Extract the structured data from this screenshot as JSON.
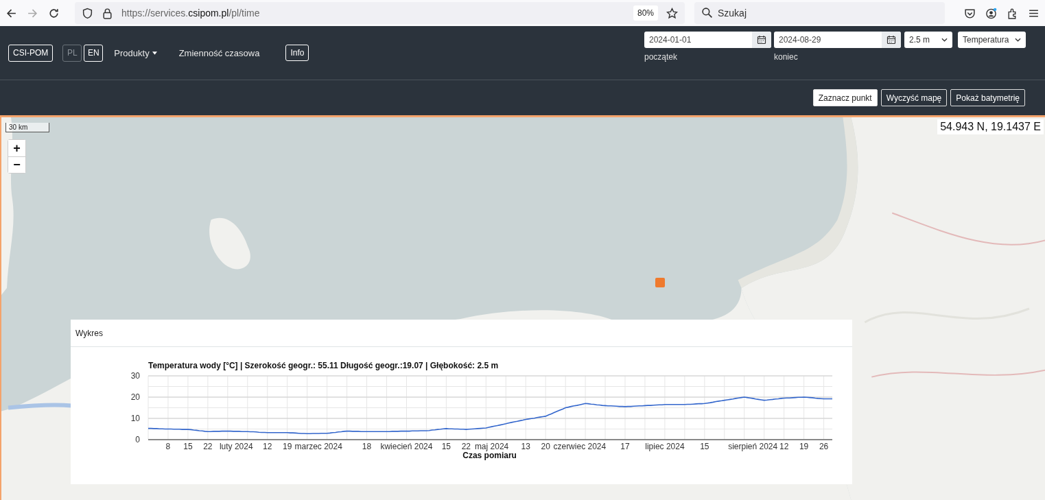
{
  "browser": {
    "url": "https://services.**csipom.pl**/pl/time",
    "zoom": "80%",
    "search": {
      "placeholder": "Szukaj"
    },
    "forward_disabled": true
  },
  "navbar": {
    "brand": "CSI-POM",
    "languages": [
      {
        "label": "PL",
        "selected": true
      },
      {
        "label": "EN",
        "selected": false
      }
    ],
    "menu": "Produkty",
    "page_title": "Zmienność czasowa",
    "info": "Info",
    "start_date": {
      "value": "2024-01-01",
      "label": "początek"
    },
    "end_date": {
      "value": "2024-08-29",
      "label": "koniec"
    },
    "depth": "2.5 m",
    "variable": "Temperatura"
  },
  "toolbar": {
    "buttons": [
      {
        "label": "Zaznacz punkt",
        "selected": true
      },
      {
        "label": "Wyczyść mapę",
        "selected": false
      },
      {
        "label": "Pokaż batymetrię",
        "selected": false
      }
    ]
  },
  "map": {
    "scale": "30 km",
    "zoom_in": "+",
    "zoom_out": "−",
    "coordinates": "54.943 N, 19.1437 E"
  },
  "chart_panel": {
    "header": "Wykres",
    "chart_data": {
      "type": "line",
      "title": "Temperatura wody [°C] | Szerokość geogr.: 55.11 Długość geogr.:19.07 | Głębokość: 2.5 m",
      "xlabel": "Czas pomiaru",
      "categories": [
        null,
        null,
        null,
        null,
        null,
        null,
        null,
        "8",
        null,
        null,
        null,
        null,
        null,
        null,
        "15",
        null,
        null,
        null,
        null,
        null,
        null,
        "22",
        null,
        null,
        null,
        null,
        null,
        null,
        null,
        null,
        null,
        "luty 2024",
        null,
        null,
        null,
        null,
        null,
        null,
        null,
        null,
        null,
        null,
        "12",
        null,
        null,
        null,
        null,
        null,
        null,
        "19",
        null,
        null,
        null,
        null,
        null,
        null,
        null,
        null,
        null,
        null,
        "marzec 2024",
        null,
        null,
        null,
        null,
        null,
        null,
        null,
        null,
        null,
        null,
        null,
        null,
        null,
        null,
        null,
        null,
        "18",
        null,
        null,
        null,
        null,
        null,
        null,
        null,
        null,
        null,
        null,
        null,
        null,
        null,
        "kwiecień 2024",
        null,
        null,
        null,
        null,
        null,
        null,
        null,
        null,
        null,
        null,
        null,
        null,
        null,
        "15",
        null,
        null,
        null,
        null,
        null,
        null,
        "22",
        null,
        null,
        null,
        null,
        null,
        null,
        null,
        null,
        "maj 2024",
        null,
        null,
        null,
        null,
        null,
        null,
        null,
        null,
        null,
        null,
        null,
        "13",
        null,
        null,
        null,
        null,
        null,
        null,
        "20",
        null,
        null,
        null,
        null,
        null,
        null,
        null,
        null,
        null,
        null,
        null,
        "czerwiec 2024",
        null,
        null,
        null,
        null,
        null,
        null,
        null,
        null,
        null,
        null,
        null,
        null,
        null,
        null,
        null,
        "17",
        null,
        null,
        null,
        null,
        null,
        null,
        null,
        null,
        null,
        null,
        null,
        null,
        null,
        "lipiec 2024",
        null,
        null,
        null,
        null,
        null,
        null,
        null,
        null,
        null,
        null,
        null,
        null,
        null,
        "15",
        null,
        null,
        null,
        null,
        null,
        null,
        null,
        null,
        null,
        null,
        null,
        null,
        null,
        null,
        null,
        null,
        "sierpień 2024",
        null,
        null,
        null,
        null,
        null,
        null,
        null,
        null,
        null,
        null,
        "12",
        null,
        null,
        null,
        null,
        null,
        null,
        "19",
        null,
        null,
        null,
        null,
        null,
        null,
        "26",
        null,
        null,
        null
      ],
      "series": [
        {
          "color": "#3366cc",
          "values": [
            5.3,
            5.3,
            5.2,
            5.2,
            5.1,
            5.1,
            5.0,
            5.0,
            5.0,
            4.9,
            4.9,
            4.9,
            4.8,
            4.8,
            4.8,
            4.7,
            4.5,
            4.4,
            4.2,
            4.1,
            3.9,
            3.8,
            3.8,
            3.9,
            3.9,
            3.9,
            4.0,
            4.0,
            4.0,
            4.0,
            3.9,
            3.9,
            3.9,
            3.8,
            3.8,
            3.8,
            3.7,
            3.7,
            3.6,
            3.5,
            3.4,
            3.4,
            3.3,
            3.3,
            3.3,
            3.3,
            3.3,
            3.3,
            3.3,
            3.3,
            3.2,
            3.2,
            3.1,
            3.0,
            2.9,
            2.9,
            2.8,
            2.8,
            2.9,
            2.9,
            2.9,
            3.0,
            3.0,
            3.0,
            3.1,
            3.3,
            3.4,
            3.6,
            3.7,
            3.9,
            4.0,
            4.0,
            3.9,
            3.9,
            3.9,
            3.8,
            3.8,
            3.8,
            3.8,
            3.8,
            3.8,
            3.8,
            3.8,
            3.8,
            3.8,
            3.8,
            3.9,
            3.9,
            3.9,
            4.0,
            4.0,
            4.0,
            4.0,
            4.1,
            4.1,
            4.1,
            4.2,
            4.2,
            4.2,
            4.3,
            4.5,
            4.6,
            4.8,
            4.9,
            5.1,
            5.2,
            5.1,
            5.1,
            5.0,
            5.0,
            4.9,
            4.9,
            4.8,
            4.9,
            5.0,
            5.1,
            5.2,
            5.3,
            5.4,
            5.5,
            5.8,
            6.1,
            6.4,
            6.6,
            6.9,
            7.2,
            7.5,
            7.8,
            8.1,
            8.4,
            8.6,
            8.9,
            9.2,
            9.5,
            9.7,
            9.9,
            10.1,
            10.4,
            10.6,
            10.8,
            11.0,
            11.6,
            12.1,
            12.7,
            13.3,
            13.9,
            14.4,
            15.0,
            15.3,
            15.6,
            15.9,
            16.1,
            16.4,
            16.7,
            17.0,
            16.9,
            16.7,
            16.6,
            16.4,
            16.3,
            16.1,
            16.0,
            15.9,
            15.9,
            15.8,
            15.7,
            15.6,
            15.6,
            15.5,
            15.6,
            15.6,
            15.7,
            15.8,
            15.9,
            15.9,
            16.0,
            16.1,
            16.1,
            16.2,
            16.3,
            16.4,
            16.4,
            16.5,
            16.5,
            16.5,
            16.5,
            16.5,
            16.5,
            16.5,
            16.5,
            16.6,
            16.6,
            16.7,
            16.8,
            16.9,
            16.9,
            17.0,
            17.2,
            17.4,
            17.6,
            17.9,
            18.1,
            18.3,
            18.5,
            18.7,
            18.9,
            19.1,
            19.4,
            19.6,
            19.8,
            20.0,
            19.8,
            19.6,
            19.4,
            19.1,
            18.9,
            18.7,
            18.5,
            18.6,
            18.8,
            18.9,
            19.1,
            19.2,
            19.4,
            19.5,
            19.6,
            19.6,
            19.7,
            19.8,
            19.9,
            19.9,
            20.0,
            19.9,
            19.8,
            19.7,
            19.5,
            19.4,
            19.3,
            19.2,
            19.2,
            19.2,
            19.2
          ]
        }
      ],
      "ylim": [
        0,
        30
      ],
      "yticks": [
        0,
        10,
        20,
        30
      ],
      "grid": true
    }
  }
}
